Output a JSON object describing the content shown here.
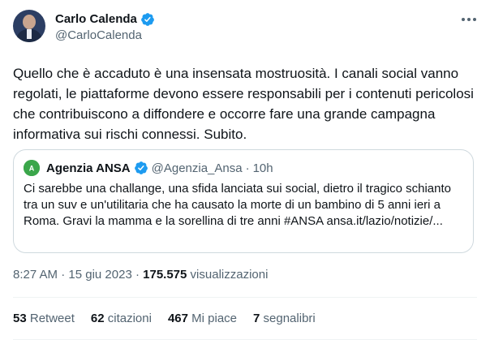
{
  "author": {
    "display_name": "Carlo Calenda",
    "handle": "@CarloCalenda"
  },
  "tweet": {
    "text": "Quello che è accaduto è una insensata mostruosità. I canali social vanno regolati, le piattaforme devono essere responsabili per i contenuti pericolosi che contribuiscono a diffondere e occorre fare una grande campagna informativa sui rischi connessi. Subito."
  },
  "quote": {
    "avatar_text": "A",
    "display_name": "Agenzia ANSA",
    "handle": "@Agenzia_Ansa",
    "separator": "·",
    "time": "10h",
    "text": "Ci sarebbe una challange, una sfida lanciata sui social, dietro il tragico schianto tra un suv e un'utilitaria che ha causato la morte di un bambino di 5 anni ieri a Roma. Gravi la mamma e la sorellina di tre anni #ANSA ansa.it/lazio/notizie/..."
  },
  "meta": {
    "time": "8:27 AM",
    "separator": "·",
    "date": "15 giu 2023",
    "views_count": "175.575",
    "views_label": "visualizzazioni"
  },
  "stats": {
    "retweets": {
      "count": "53",
      "label": "Retweet"
    },
    "quotes": {
      "count": "62",
      "label": "citazioni"
    },
    "likes": {
      "count": "467",
      "label": "Mi piace"
    },
    "bookmarks": {
      "count": "7",
      "label": "segnalibri"
    }
  },
  "colors": {
    "verified_blue": "#1d9bf0",
    "secondary_text": "#536471",
    "border": "#cfd9de",
    "ansa_green": "#3aa64a"
  }
}
